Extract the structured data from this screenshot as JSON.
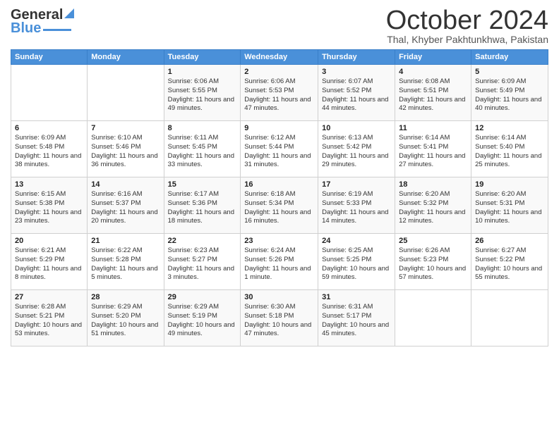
{
  "header": {
    "logo_general": "General",
    "logo_blue": "Blue",
    "month_title": "October 2024",
    "location": "Thal, Khyber Pakhtunkhwa, Pakistan"
  },
  "days_of_week": [
    "Sunday",
    "Monday",
    "Tuesday",
    "Wednesday",
    "Thursday",
    "Friday",
    "Saturday"
  ],
  "weeks": [
    [
      {
        "date": "",
        "sunrise": "",
        "sunset": "",
        "daylight": ""
      },
      {
        "date": "",
        "sunrise": "",
        "sunset": "",
        "daylight": ""
      },
      {
        "date": "1",
        "sunrise": "Sunrise: 6:06 AM",
        "sunset": "Sunset: 5:55 PM",
        "daylight": "Daylight: 11 hours and 49 minutes."
      },
      {
        "date": "2",
        "sunrise": "Sunrise: 6:06 AM",
        "sunset": "Sunset: 5:53 PM",
        "daylight": "Daylight: 11 hours and 47 minutes."
      },
      {
        "date": "3",
        "sunrise": "Sunrise: 6:07 AM",
        "sunset": "Sunset: 5:52 PM",
        "daylight": "Daylight: 11 hours and 44 minutes."
      },
      {
        "date": "4",
        "sunrise": "Sunrise: 6:08 AM",
        "sunset": "Sunset: 5:51 PM",
        "daylight": "Daylight: 11 hours and 42 minutes."
      },
      {
        "date": "5",
        "sunrise": "Sunrise: 6:09 AM",
        "sunset": "Sunset: 5:49 PM",
        "daylight": "Daylight: 11 hours and 40 minutes."
      }
    ],
    [
      {
        "date": "6",
        "sunrise": "Sunrise: 6:09 AM",
        "sunset": "Sunset: 5:48 PM",
        "daylight": "Daylight: 11 hours and 38 minutes."
      },
      {
        "date": "7",
        "sunrise": "Sunrise: 6:10 AM",
        "sunset": "Sunset: 5:46 PM",
        "daylight": "Daylight: 11 hours and 36 minutes."
      },
      {
        "date": "8",
        "sunrise": "Sunrise: 6:11 AM",
        "sunset": "Sunset: 5:45 PM",
        "daylight": "Daylight: 11 hours and 33 minutes."
      },
      {
        "date": "9",
        "sunrise": "Sunrise: 6:12 AM",
        "sunset": "Sunset: 5:44 PM",
        "daylight": "Daylight: 11 hours and 31 minutes."
      },
      {
        "date": "10",
        "sunrise": "Sunrise: 6:13 AM",
        "sunset": "Sunset: 5:42 PM",
        "daylight": "Daylight: 11 hours and 29 minutes."
      },
      {
        "date": "11",
        "sunrise": "Sunrise: 6:14 AM",
        "sunset": "Sunset: 5:41 PM",
        "daylight": "Daylight: 11 hours and 27 minutes."
      },
      {
        "date": "12",
        "sunrise": "Sunrise: 6:14 AM",
        "sunset": "Sunset: 5:40 PM",
        "daylight": "Daylight: 11 hours and 25 minutes."
      }
    ],
    [
      {
        "date": "13",
        "sunrise": "Sunrise: 6:15 AM",
        "sunset": "Sunset: 5:38 PM",
        "daylight": "Daylight: 11 hours and 23 minutes."
      },
      {
        "date": "14",
        "sunrise": "Sunrise: 6:16 AM",
        "sunset": "Sunset: 5:37 PM",
        "daylight": "Daylight: 11 hours and 20 minutes."
      },
      {
        "date": "15",
        "sunrise": "Sunrise: 6:17 AM",
        "sunset": "Sunset: 5:36 PM",
        "daylight": "Daylight: 11 hours and 18 minutes."
      },
      {
        "date": "16",
        "sunrise": "Sunrise: 6:18 AM",
        "sunset": "Sunset: 5:34 PM",
        "daylight": "Daylight: 11 hours and 16 minutes."
      },
      {
        "date": "17",
        "sunrise": "Sunrise: 6:19 AM",
        "sunset": "Sunset: 5:33 PM",
        "daylight": "Daylight: 11 hours and 14 minutes."
      },
      {
        "date": "18",
        "sunrise": "Sunrise: 6:20 AM",
        "sunset": "Sunset: 5:32 PM",
        "daylight": "Daylight: 11 hours and 12 minutes."
      },
      {
        "date": "19",
        "sunrise": "Sunrise: 6:20 AM",
        "sunset": "Sunset: 5:31 PM",
        "daylight": "Daylight: 11 hours and 10 minutes."
      }
    ],
    [
      {
        "date": "20",
        "sunrise": "Sunrise: 6:21 AM",
        "sunset": "Sunset: 5:29 PM",
        "daylight": "Daylight: 11 hours and 8 minutes."
      },
      {
        "date": "21",
        "sunrise": "Sunrise: 6:22 AM",
        "sunset": "Sunset: 5:28 PM",
        "daylight": "Daylight: 11 hours and 5 minutes."
      },
      {
        "date": "22",
        "sunrise": "Sunrise: 6:23 AM",
        "sunset": "Sunset: 5:27 PM",
        "daylight": "Daylight: 11 hours and 3 minutes."
      },
      {
        "date": "23",
        "sunrise": "Sunrise: 6:24 AM",
        "sunset": "Sunset: 5:26 PM",
        "daylight": "Daylight: 11 hours and 1 minute."
      },
      {
        "date": "24",
        "sunrise": "Sunrise: 6:25 AM",
        "sunset": "Sunset: 5:25 PM",
        "daylight": "Daylight: 10 hours and 59 minutes."
      },
      {
        "date": "25",
        "sunrise": "Sunrise: 6:26 AM",
        "sunset": "Sunset: 5:23 PM",
        "daylight": "Daylight: 10 hours and 57 minutes."
      },
      {
        "date": "26",
        "sunrise": "Sunrise: 6:27 AM",
        "sunset": "Sunset: 5:22 PM",
        "daylight": "Daylight: 10 hours and 55 minutes."
      }
    ],
    [
      {
        "date": "27",
        "sunrise": "Sunrise: 6:28 AM",
        "sunset": "Sunset: 5:21 PM",
        "daylight": "Daylight: 10 hours and 53 minutes."
      },
      {
        "date": "28",
        "sunrise": "Sunrise: 6:29 AM",
        "sunset": "Sunset: 5:20 PM",
        "daylight": "Daylight: 10 hours and 51 minutes."
      },
      {
        "date": "29",
        "sunrise": "Sunrise: 6:29 AM",
        "sunset": "Sunset: 5:19 PM",
        "daylight": "Daylight: 10 hours and 49 minutes."
      },
      {
        "date": "30",
        "sunrise": "Sunrise: 6:30 AM",
        "sunset": "Sunset: 5:18 PM",
        "daylight": "Daylight: 10 hours and 47 minutes."
      },
      {
        "date": "31",
        "sunrise": "Sunrise: 6:31 AM",
        "sunset": "Sunset: 5:17 PM",
        "daylight": "Daylight: 10 hours and 45 minutes."
      },
      {
        "date": "",
        "sunrise": "",
        "sunset": "",
        "daylight": ""
      },
      {
        "date": "",
        "sunrise": "",
        "sunset": "",
        "daylight": ""
      }
    ]
  ]
}
